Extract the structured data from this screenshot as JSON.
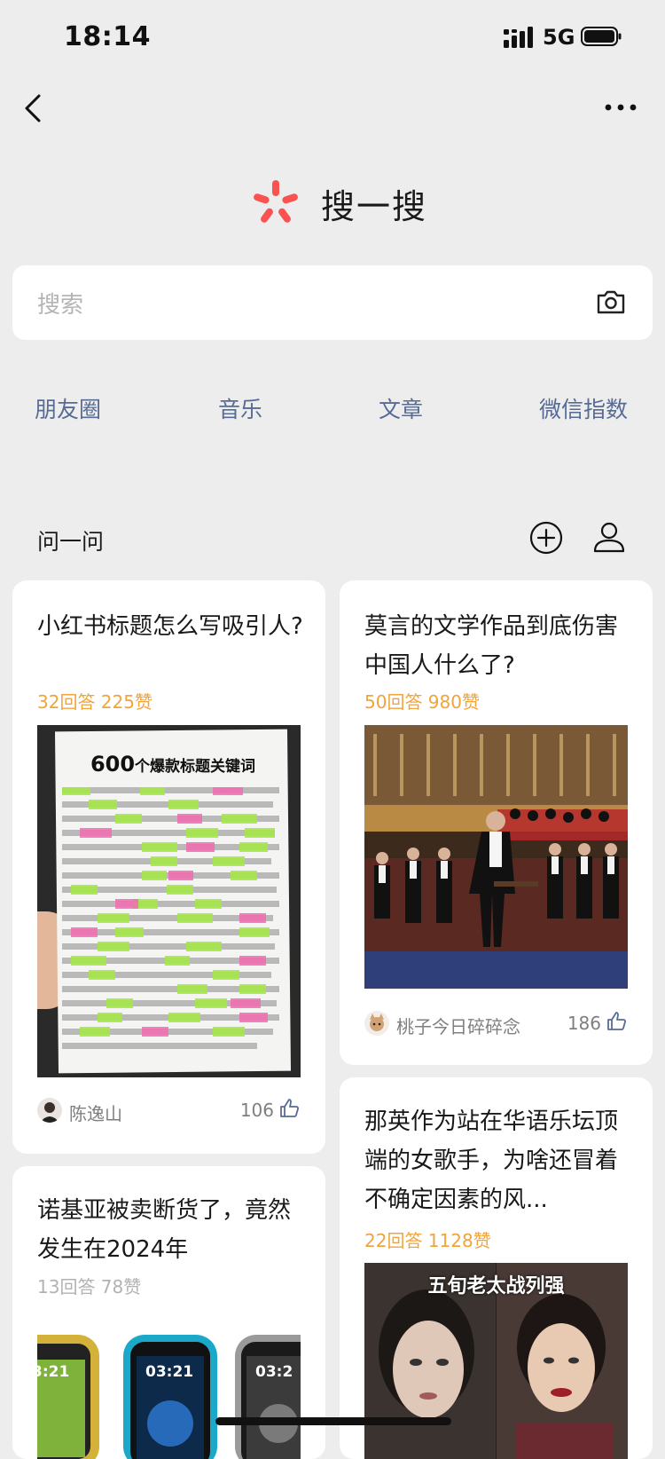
{
  "status": {
    "time": "18:14",
    "network": "5G"
  },
  "nav": {
    "back_icon": "chevron-left-icon",
    "more_icon": "more-dots-icon"
  },
  "brand": {
    "title": "搜一搜",
    "logo_icon": "sou-logo-icon",
    "logo_color": "#fa5151"
  },
  "search": {
    "placeholder": "搜索",
    "camera_icon": "camera-icon"
  },
  "quick_links": [
    "朋友圈",
    "音乐",
    "文章",
    "微信指数"
  ],
  "ask": {
    "title": "问一问",
    "add_icon": "add-circle-icon",
    "profile_icon": "user-icon"
  },
  "colors": {
    "link": "#576b95",
    "stats_orange": "#f0a43a",
    "stats_gray": "#b2b2b2",
    "background": "#ededed"
  },
  "cards": [
    {
      "title": "小红书标题怎么写吸引人?",
      "stats": "32回答  225赞",
      "image": {
        "heading_num": "600",
        "heading_text": "个爆款标题关键词"
      },
      "author": "陈逸山",
      "likes": "106"
    },
    {
      "title": "莫言的文学作品到底伤害中国人什么了?",
      "stats": "50回答  980赞",
      "author": "桃子今日碎碎念",
      "likes": "186"
    },
    {
      "title": "诺基亚被卖断货了，竟然发生在2024年",
      "stats": "13回答  78赞",
      "image": {
        "phone_times": [
          "3:21",
          "03:21",
          "03:2"
        ]
      }
    },
    {
      "title": "那英作为站在华语乐坛顶端的女歌手，为啥还冒着不确定因素的风...",
      "stats": "22回答  1128赞",
      "image": {
        "caption": "五旬老太战列强"
      }
    }
  ]
}
